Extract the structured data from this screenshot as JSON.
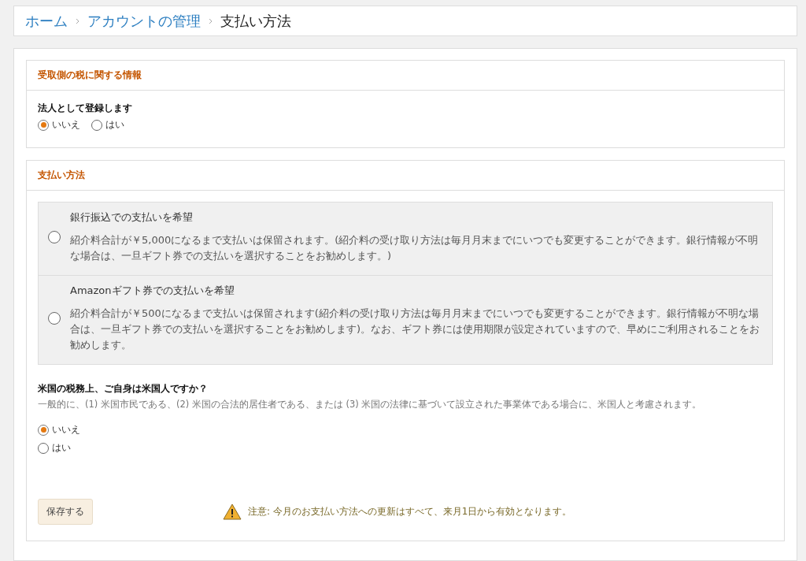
{
  "breadcrumb": [
    {
      "label": "ホーム",
      "kind": "link"
    },
    {
      "label": "アカウントの管理",
      "kind": "link"
    },
    {
      "label": "支払い方法",
      "kind": "current"
    }
  ],
  "tax_section": {
    "title": "受取側の税に関する情報",
    "question": "法人として登録します",
    "options": [
      {
        "label": "いいえ",
        "selected": true
      },
      {
        "label": "はい",
        "selected": false
      }
    ]
  },
  "payment_section": {
    "title": "支払い方法",
    "methods": [
      {
        "title": "銀行振込での支払いを希望",
        "description": "紹介料合計が￥5,000になるまで支払いは保留されます。(紹介料の受け取り方法は毎月月末までにいつでも変更することができます。銀行情報が不明な場合は、一旦ギフト券での支払いを選択することをお勧めします。)",
        "selected": false
      },
      {
        "title": "Amazonギフト券での支払いを希望",
        "description": "紹介料合計が￥500になるまで支払いは保留されます(紹介料の受け取り方法は毎月月末までにいつでも変更することができます。銀行情報が不明な場合は、一旦ギフト券での支払いを選択することをお勧めします)。なお、ギフト券には使用期限が設定されていますので、早めにご利用されることをお勧めします。",
        "selected": false
      }
    ],
    "us_question": "米国の税務上、ご自身は米国人ですか？",
    "us_hint": "一般的に、(1) 米国市民である、(2) 米国の合法的居住者である、または (3) 米国の法律に基づいて設立された事業体である場合に、米国人と考慮されます。",
    "us_options": [
      {
        "label": "いいえ",
        "selected": true
      },
      {
        "label": "はい",
        "selected": false
      }
    ],
    "save_button": "保存する",
    "notice": "注意: 今月のお支払い方法への更新はすべて、来月1日から有効となります。"
  }
}
